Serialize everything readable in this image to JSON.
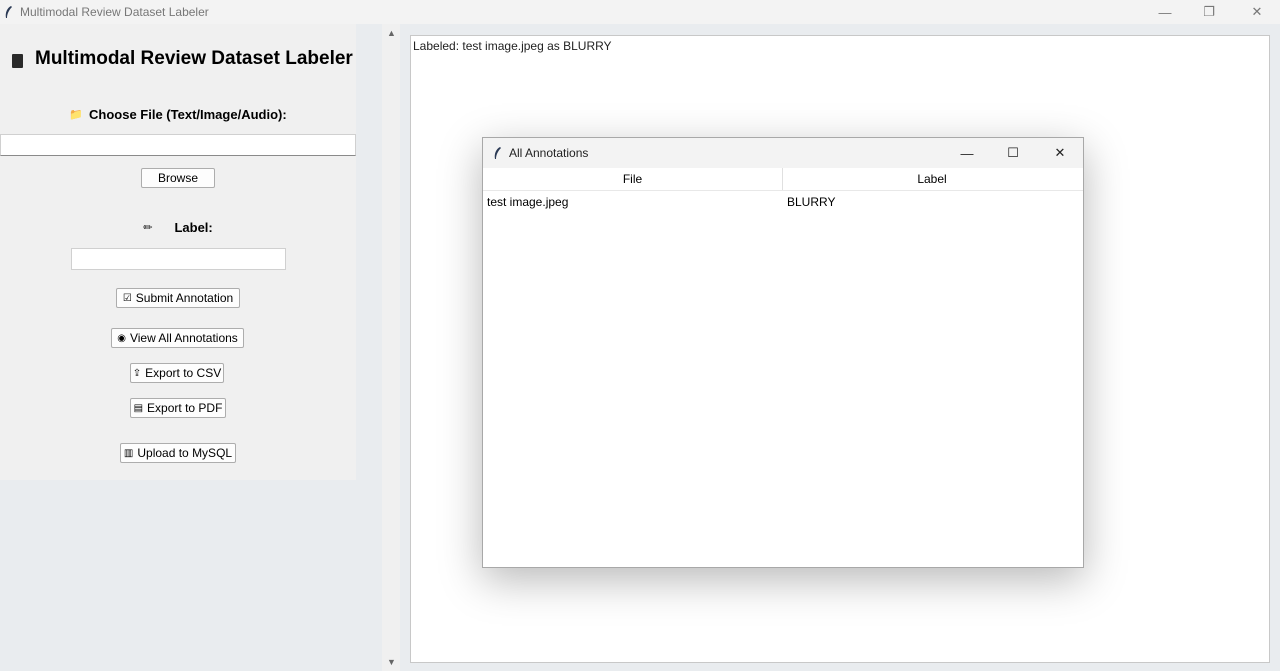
{
  "window": {
    "title": "Multimodal Review Dataset Labeler",
    "controls": {
      "minimize": "—",
      "maximize": "❐",
      "close": "✕"
    }
  },
  "left_panel": {
    "app_title": "Multimodal Review Dataset Labeler",
    "choose_file_label": "Choose File (Text/Image/Audio):",
    "file_path_value": "",
    "browse_button": "Browse",
    "label_caption": "Label:",
    "label_value": "",
    "buttons": {
      "submit": "Submit Annotation",
      "view_all": "View All Annotations",
      "export_csv": "Export to CSV",
      "export_pdf": "Export to PDF",
      "upload_mysql": "Upload to MySQL"
    },
    "icons": {
      "title": "book-icon",
      "folder": "📁",
      "pen": "✏",
      "checkbox": "☑",
      "eye": "◉",
      "export": "⇪",
      "page": "▤",
      "db": "▥"
    }
  },
  "text_area": {
    "status": "Labeled: test image.jpeg as BLURRY"
  },
  "dialog": {
    "title": "All Annotations",
    "controls": {
      "minimize": "—",
      "maximize": "☐",
      "close": "✕"
    },
    "columns": [
      "File",
      "Label"
    ],
    "rows": [
      {
        "file": "test image.jpeg",
        "label": "BLURRY"
      }
    ]
  }
}
